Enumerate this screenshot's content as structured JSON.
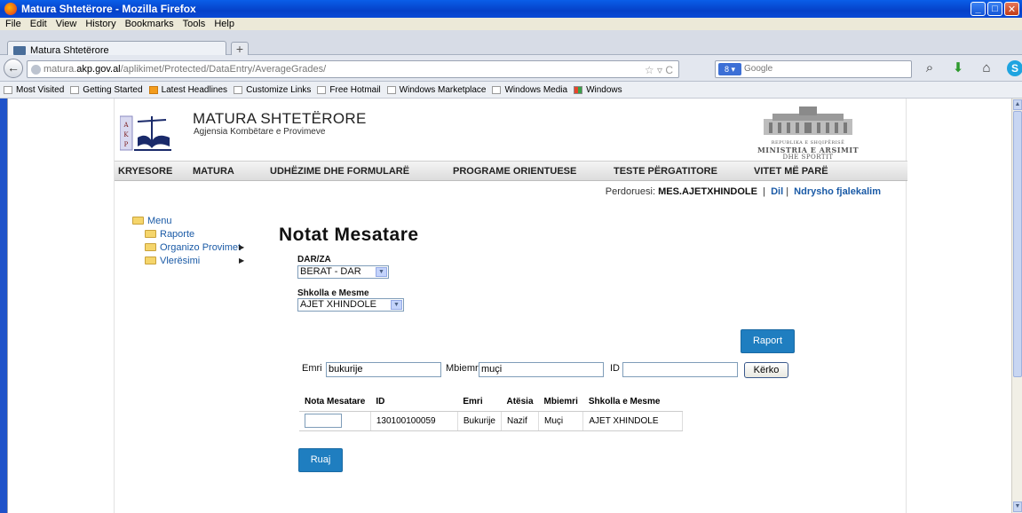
{
  "window": {
    "title": "Matura Shtetërore - Mozilla Firefox"
  },
  "menubar": [
    "File",
    "Edit",
    "View",
    "History",
    "Bookmarks",
    "Tools",
    "Help"
  ],
  "tab": {
    "title": "Matura Shtetërore"
  },
  "url": {
    "prefix": "matura.",
    "host": "akp.gov.al",
    "path": "/aplikimet/Protected/DataEntry/AverageGrades/"
  },
  "search": {
    "placeholder": "Google"
  },
  "bookmarks": [
    "Most Visited",
    "Getting Started",
    "Latest Headlines",
    "Customize Links",
    "Free Hotmail",
    "Windows Marketplace",
    "Windows Media",
    "Windows"
  ],
  "site": {
    "title": "MATURA SHTETËRORE",
    "subtitle": "Agjensia Kombëtare e Provimeve",
    "ministry": [
      "REPUBLIKA E SHQIPËRISË",
      "MINISTRIA E ARSIMIT",
      "DHE SPORTIT"
    ]
  },
  "nav": [
    "KRYESORE",
    "MATURA",
    "UDHËZIME DHE FORMULARË",
    "PROGRAME ORIENTUESE",
    "TESTE PËRGATITORE",
    "VITET MË PARË"
  ],
  "user": {
    "label": "Perdoruesi:",
    "name": "MES.AJETXHINDOLE",
    "sep1": "|",
    "lang": "Dil",
    "sep2": "|",
    "change_pw": "Ndrysho fjalekalim"
  },
  "leftmenu": {
    "root": "Menu",
    "items": [
      "Raporte",
      "Organizo Provimet",
      "Vlerësimi"
    ]
  },
  "page": {
    "heading": "Notat Mesatare",
    "darza_label": "DAR/ZA",
    "darza_value": "BERAT - DAR",
    "school_label": "Shkolla e Mesme",
    "school_value": "AJET XHINDOLE",
    "raport_button": "Raport",
    "save_button": "Ruaj"
  },
  "filter": {
    "emri_label": "Emri",
    "emri_value": "bukurije",
    "mbiemri_label": "Mbiemri",
    "mbiemri_value": "muçi",
    "id_label": "ID",
    "id_value": "",
    "search_button": "Kërko"
  },
  "table": {
    "headers": [
      "Nota Mesatare",
      "ID",
      "Emri",
      "Atësia",
      "Mbiemri",
      "Shkolla e Mesme"
    ],
    "rows": [
      {
        "nota": "",
        "id": "130100100059",
        "emri": "Bukurije",
        "atesia": "Nazif",
        "mbiemri": "Muçi",
        "shkolla": "AJET XHINDOLE"
      }
    ]
  }
}
